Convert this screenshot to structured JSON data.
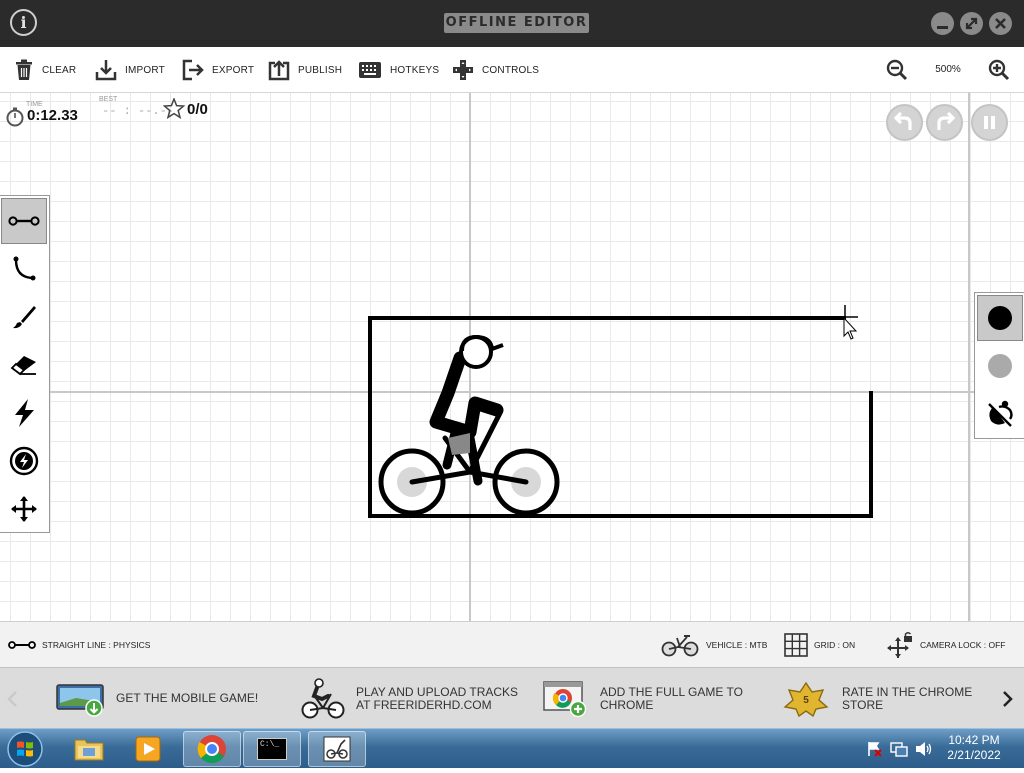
{
  "titlebar": {
    "title": "OFFLINE EDITOR",
    "info_label": "i"
  },
  "toolbar": {
    "items": [
      {
        "label": "CLEAR",
        "icon": "trash-icon"
      },
      {
        "label": "IMPORT",
        "icon": "import-icon"
      },
      {
        "label": "EXPORT",
        "icon": "export-icon"
      },
      {
        "label": "PUBLISH",
        "icon": "publish-icon"
      },
      {
        "label": "HOTKEYS",
        "icon": "keyboard-icon"
      },
      {
        "label": "CONTROLS",
        "icon": "gamepad-icon"
      }
    ],
    "zoom": "500%"
  },
  "hud": {
    "time_label": "TIME",
    "time_value": "0:12.33",
    "best_label": "BEST",
    "best_value": "-- : --.--",
    "stars_value": "0/0"
  },
  "left_tools": [
    {
      "name": "straight-line",
      "icon": "line-tool-icon",
      "active": true
    },
    {
      "name": "curve",
      "icon": "curve-tool-icon",
      "active": false
    },
    {
      "name": "brush",
      "icon": "brush-tool-icon",
      "active": false
    },
    {
      "name": "eraser",
      "icon": "eraser-icon",
      "active": false
    },
    {
      "name": "powerup",
      "icon": "lightning-icon",
      "active": false
    },
    {
      "name": "boost",
      "icon": "boost-icon",
      "active": false
    },
    {
      "name": "camera",
      "icon": "move-icon",
      "active": false
    }
  ],
  "right_tools": [
    {
      "name": "physics-line",
      "color": "#000000",
      "active": true
    },
    {
      "name": "scenery-line",
      "color": "#aaaaaa",
      "active": false
    },
    {
      "name": "invisible",
      "icon": "no-color-icon",
      "active": false
    }
  ],
  "statusbar": {
    "tool_label": "STRAIGHT LINE : PHYSICS",
    "vehicle_label": "VEHICLE : MTB",
    "grid_label": "GRID : ON",
    "camera_label": "CAMERA LOCK : OFF"
  },
  "promo": {
    "items": [
      {
        "line1": "GET THE MOBILE GAME!",
        "line2": ""
      },
      {
        "line1": "PLAY AND UPLOAD TRACKS",
        "line2": "AT FREERIDERHD.COM"
      },
      {
        "line1": "ADD THE FULL GAME TO",
        "line2": "CHROME"
      },
      {
        "line1": "RATE IN THE CHROME",
        "line2": "STORE"
      }
    ],
    "badge_number": "5"
  },
  "taskbar": {
    "time": "10:42 PM",
    "date": "2/21/2022",
    "cmd_text": "C:\\_"
  },
  "colors": {
    "titlebar": "#2b2b2b",
    "track_line": "#000000",
    "taskbar": "#3a6c98"
  }
}
